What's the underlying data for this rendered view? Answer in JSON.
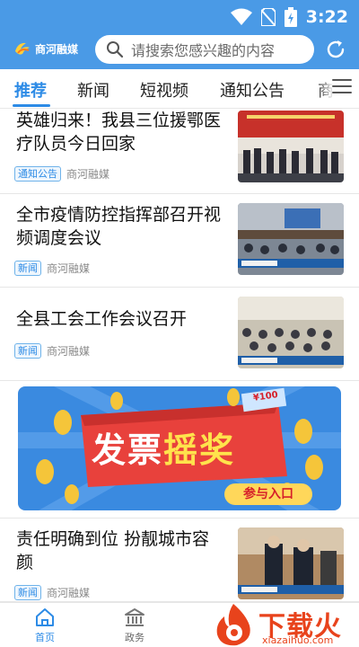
{
  "status_bar": {
    "time": "3:22"
  },
  "header": {
    "brand": "商河融媒",
    "search_placeholder": "请搜索您感兴趣的内容"
  },
  "tabs": [
    {
      "label": "推荐",
      "active": true
    },
    {
      "label": "新闻"
    },
    {
      "label": "短视频"
    },
    {
      "label": "通知公告"
    },
    {
      "label": "商"
    }
  ],
  "news": [
    {
      "title": "英雄归来！我县三位援鄂医疗队员今日回家",
      "tag": "通知公告",
      "source": "商河融媒"
    },
    {
      "title": "全市疫情防控指挥部召开视频调度会议",
      "tag": "新闻",
      "source": "商河融媒"
    },
    {
      "title": "全县工会工作会议召开",
      "tag": "新闻",
      "source": "商河融媒"
    },
    {
      "title": "责任明确到位 扮靓城市容颜",
      "tag": "新闻",
      "source": "商河融媒"
    }
  ],
  "banner": {
    "title_part1": "发票",
    "title_part2": "摇奖",
    "cta": "参与入口",
    "badge": "¥100"
  },
  "bottom_nav": [
    {
      "label": "首页",
      "active": true
    },
    {
      "label": "政务"
    }
  ],
  "watermark": {
    "text": "下载火",
    "sub": "xiazaihuo.com"
  },
  "colors": {
    "brand_blue": "#4a9ae6",
    "accent": "#2d8be6",
    "banner_blue": "#3a8ae0",
    "cta_yellow": "#ffd75a",
    "watermark_red": "#e8431c"
  }
}
